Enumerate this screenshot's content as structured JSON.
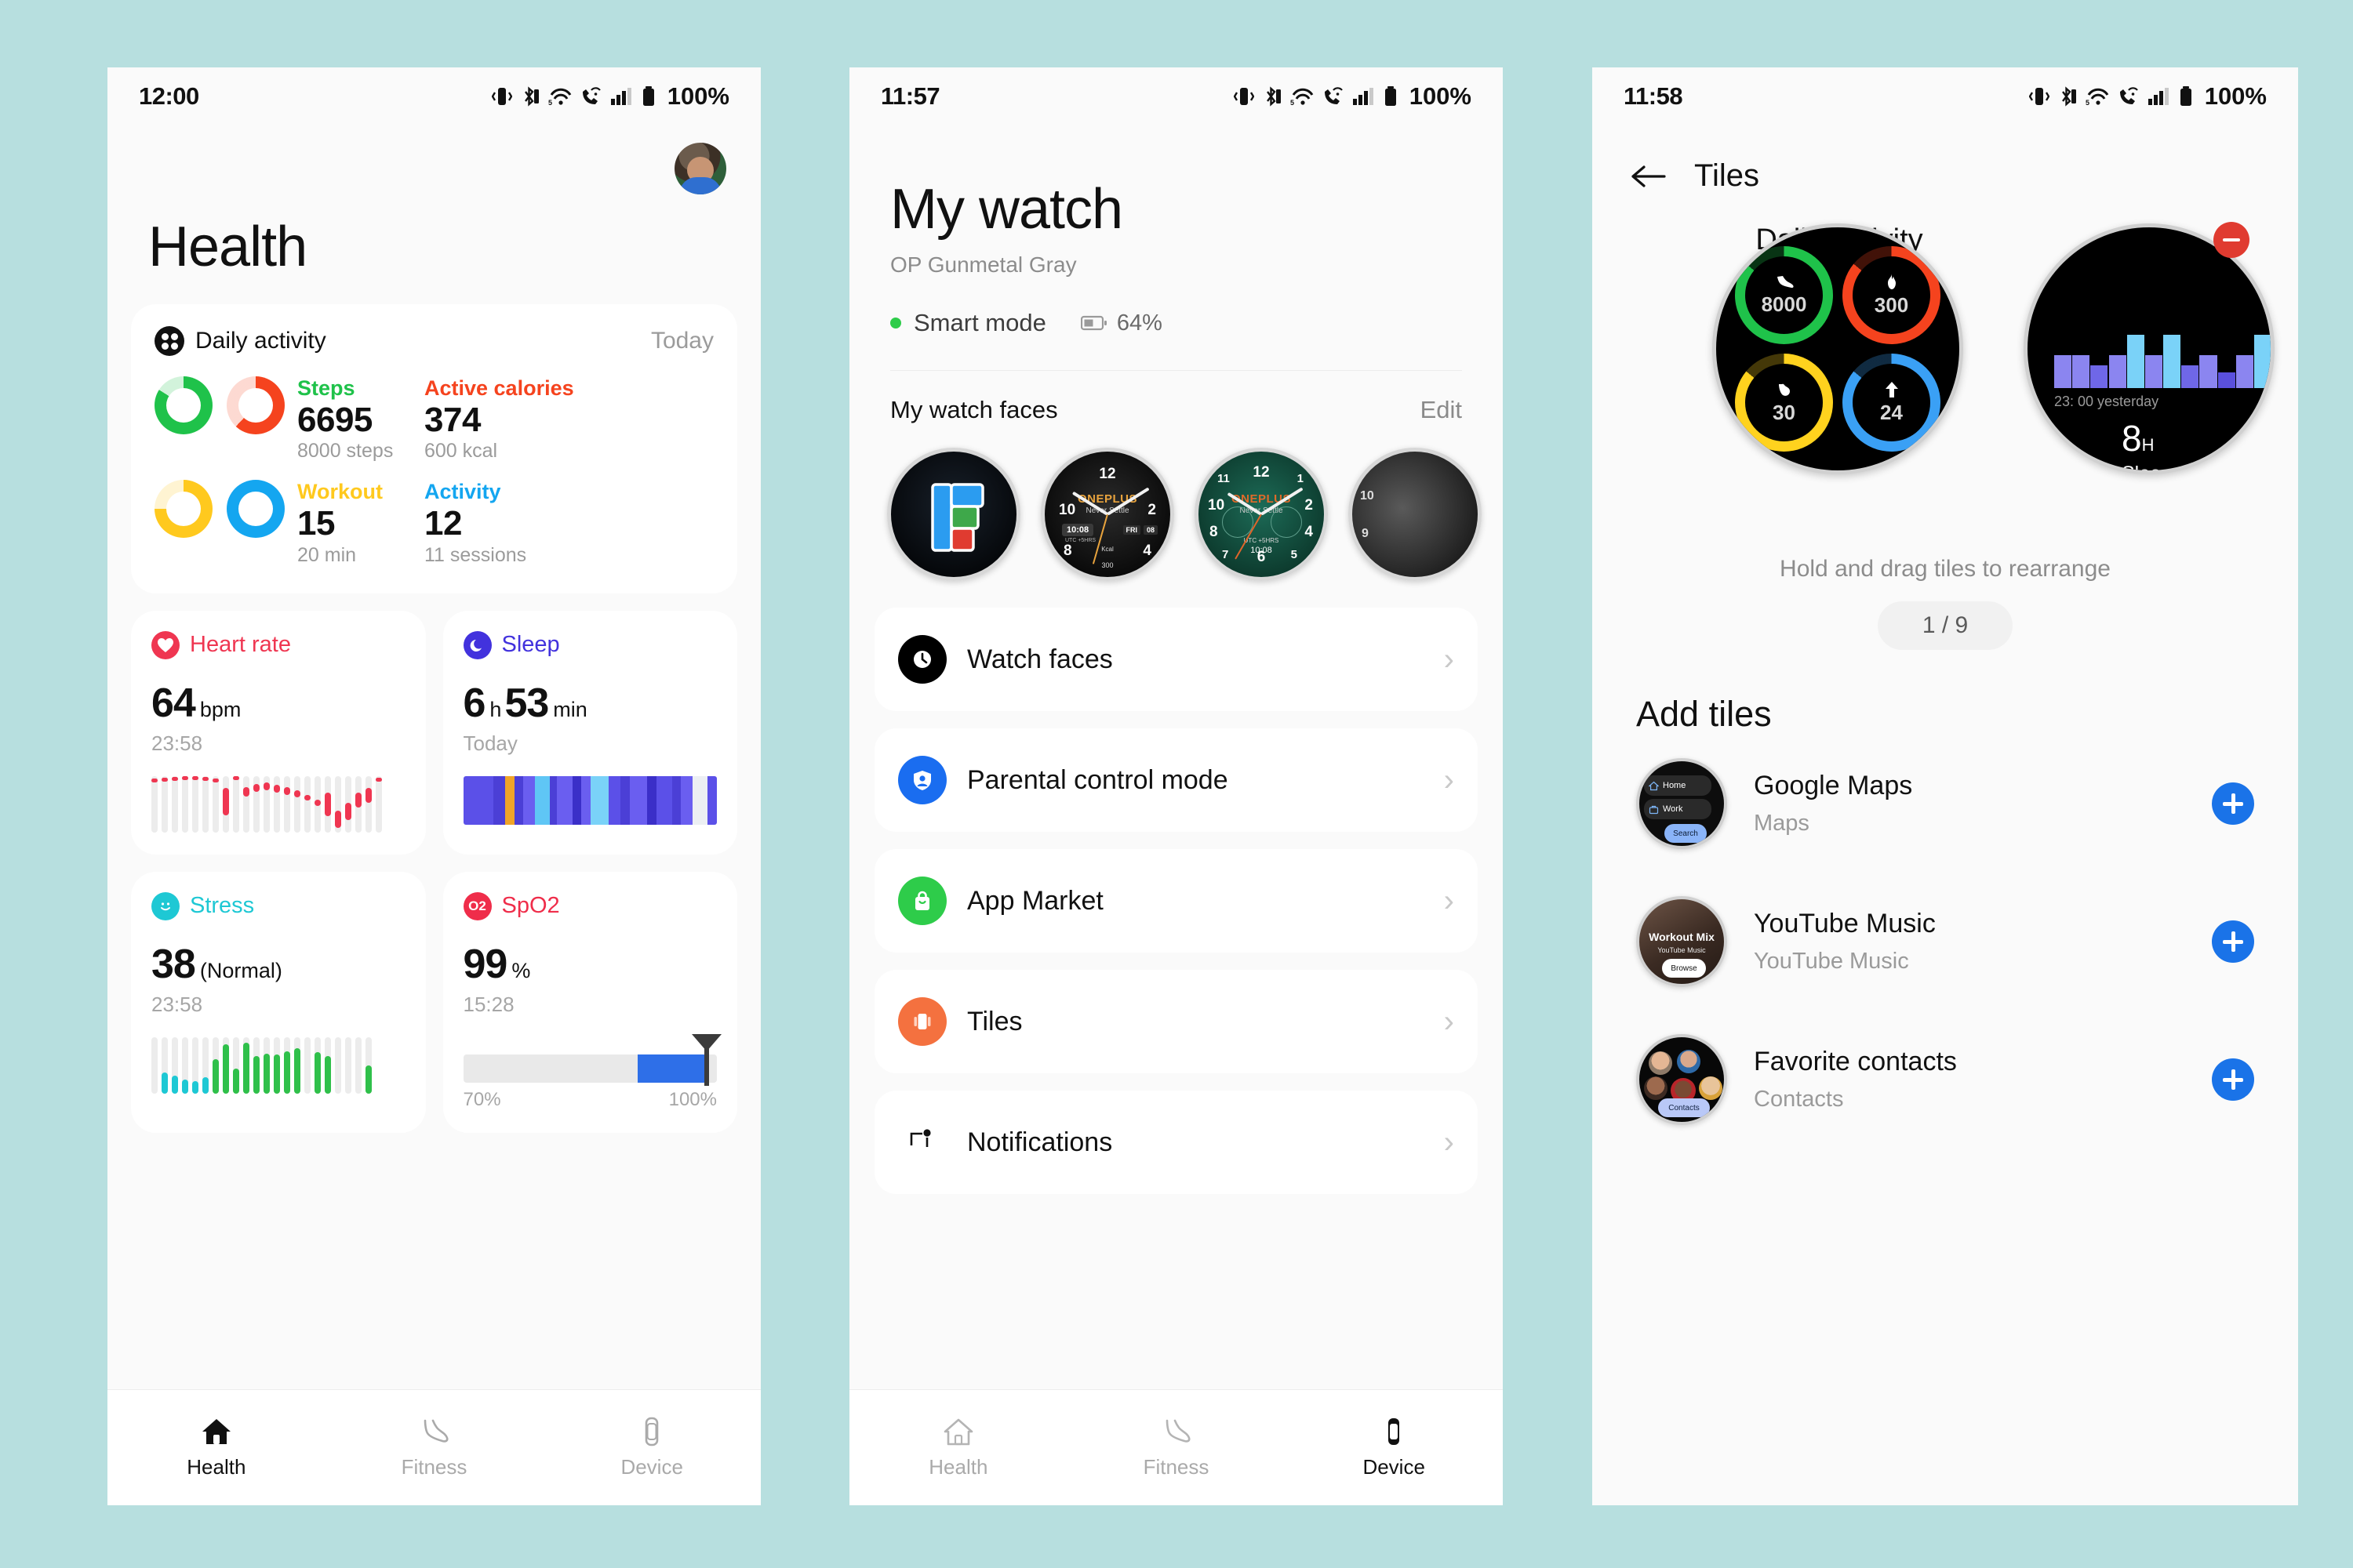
{
  "background_color": "#b7dfdf",
  "panel_health": {
    "status": {
      "time": "12:00",
      "battery": "100%",
      "icons": [
        "vibrate-icon",
        "bluetooth-icon",
        "wifi-5-icon",
        "call-wifi-icon",
        "signal-icon",
        "battery-icon"
      ]
    },
    "page_title": "Health",
    "daily_activity": {
      "card_title": "Daily activity",
      "period": "Today",
      "metrics": [
        {
          "label": "Steps",
          "value": "6695",
          "goal": "8000 steps",
          "color": "#1fc24a",
          "pct": 84
        },
        {
          "label": "Active calories",
          "value": "374",
          "goal": "600 kcal",
          "color": "#f5431e",
          "pct": 62
        },
        {
          "label": "Workout",
          "value": "15",
          "goal": "20 min",
          "color": "#ffc91e",
          "pct": 75
        },
        {
          "label": "Activity",
          "value": "12",
          "goal": "11 sessions",
          "color": "#14a6f0",
          "pct": 100
        }
      ]
    },
    "heart_rate": {
      "title": "Heart rate",
      "value": "64",
      "unit": "bpm",
      "time": "23:58",
      "color": "#ef3651"
    },
    "sleep": {
      "title": "Sleep",
      "hours": "6",
      "h_unit": "h",
      "minutes": "53",
      "min_unit": "min",
      "time": "Today",
      "color": "#4232dd"
    },
    "stress": {
      "title": "Stress",
      "value": "38",
      "state": "(Normal)",
      "time": "23:58",
      "color": "#1ec8d4"
    },
    "spo2": {
      "title": "SpO2",
      "icon_text": "O2",
      "value": "99",
      "unit": "%",
      "time": "15:28",
      "color": "#ef2d4a",
      "scale_min": "70%",
      "scale_max": "100%",
      "fill_pct": 72
    },
    "bottom_nav": {
      "active": "Health",
      "items": [
        {
          "label": "Health",
          "icon": "home-icon"
        },
        {
          "label": "Fitness",
          "icon": "shoe-icon"
        },
        {
          "label": "Device",
          "icon": "watch-icon"
        }
      ]
    }
  },
  "panel_watch": {
    "status": {
      "time": "11:57",
      "battery": "100%"
    },
    "page_title": "My watch",
    "device_name": "OP Gunmetal Gray",
    "mode_label": "Smart mode",
    "battery_pct": "64%",
    "watch_faces_header": "My watch faces",
    "edit_label": "Edit",
    "watch_faces": [
      {
        "name": "flipboard-face",
        "brand": "",
        "style": "logo"
      },
      {
        "name": "oneplus-dark-face",
        "brand": "ONEPLUS",
        "tagline": "Never Settle",
        "time": "10:08",
        "tz": "UTC +5HRS",
        "day": "FRI",
        "date": "08",
        "kcal_label": "Kcal",
        "kcal": "300"
      },
      {
        "name": "oneplus-green-face",
        "brand": "ONEPLUS",
        "tagline": "Never Settle",
        "time": "10:08",
        "tz": "UTC +5HRS"
      },
      {
        "name": "oneplus-gray-face",
        "brand": "",
        "style": "partial"
      }
    ],
    "menu": [
      {
        "label": "Watch faces",
        "icon": "clock-icon",
        "color": "#000000"
      },
      {
        "label": "Parental control mode",
        "icon": "shield-person-icon",
        "color": "#1a6df0"
      },
      {
        "label": "App Market",
        "icon": "shopping-bag-icon",
        "color": "#2ecc4a"
      },
      {
        "label": "Tiles",
        "icon": "tiles-icon",
        "color": "#f4713f"
      },
      {
        "label": "Notifications",
        "icon": "notification-icon",
        "color": "#111111"
      }
    ],
    "bottom_nav": {
      "active": "Device",
      "items": [
        {
          "label": "Health",
          "icon": "home-icon"
        },
        {
          "label": "Fitness",
          "icon": "shoe-icon"
        },
        {
          "label": "Device",
          "icon": "watch-icon"
        }
      ]
    }
  },
  "panel_tiles": {
    "status": {
      "time": "11:58",
      "battery": "100%"
    },
    "back_icon": "back-arrow-icon",
    "page_title": "Tiles",
    "current_tile": {
      "name": "Daily Activity",
      "rings": [
        {
          "metric": "steps",
          "value": "8000",
          "color": "#1fc24a",
          "icon": "shoe-icon",
          "pct": 86
        },
        {
          "metric": "calories",
          "value": "300",
          "color": "#f5431e",
          "icon": "flame-icon",
          "pct": 86
        },
        {
          "metric": "workout",
          "value": "30",
          "color": "#ffd21e",
          "icon": "muscle-icon",
          "pct": 86
        },
        {
          "metric": "activity",
          "value": "24",
          "color": "#3aa0f5",
          "icon": "arrow-up-icon",
          "pct": 86
        }
      ]
    },
    "next_tile": {
      "name_partial": "S",
      "chart_label": "23: 00 yesterday",
      "value": "8",
      "unit": "H",
      "caption": "Slee"
    },
    "hint": "Hold and drag tiles to rearrange",
    "pager": "1 / 9",
    "add_section_title": "Add tiles",
    "add_items": [
      {
        "name": "Google Maps",
        "sub": "Maps",
        "preview": "maps-preview",
        "chips": [
          "Home",
          "Work",
          "Search"
        ],
        "action": "add-button"
      },
      {
        "name": "YouTube Music",
        "sub": "YouTube Music",
        "preview": "ytmusic-preview",
        "chips": [
          "Workout Mix",
          "YouTube Music",
          "Browse"
        ],
        "action": "add-button"
      },
      {
        "name": "Favorite contacts",
        "sub": "Contacts",
        "preview": "contacts-preview",
        "chips": [
          "Contacts"
        ],
        "action": "add-button"
      }
    ]
  }
}
